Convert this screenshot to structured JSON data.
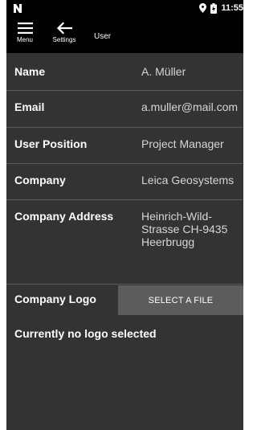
{
  "status_bar": {
    "app_icon": "n-logo-icon",
    "time": "11:55",
    "icons": [
      "location-pin-icon",
      "battery-icon"
    ]
  },
  "toolbar": {
    "menu_label": "Menu",
    "menu_icon": "hamburger-menu-icon",
    "back_label": "Settings",
    "back_icon": "arrow-left-icon",
    "title": "User"
  },
  "fields": [
    {
      "label": "Name",
      "value": "A. Müller"
    },
    {
      "label": "Email",
      "value": "a.muller@mail.com"
    },
    {
      "label": "User Position",
      "value": "Project Manager"
    },
    {
      "label": "Company",
      "value": "Leica Geosystems"
    },
    {
      "label": "Company Address",
      "value_lines": [
        "Heinrich-Wild-",
        "Strasse CH-9435",
        "Heerbrugg"
      ]
    }
  ],
  "logo": {
    "label": "Company Logo",
    "button_label": "SELECT A FILE",
    "status": "Currently no logo selected"
  },
  "colors": {
    "background": "#333333",
    "toolbar": "#000000",
    "button": "#5c5c5c",
    "value_text": "#d6d6d6"
  }
}
